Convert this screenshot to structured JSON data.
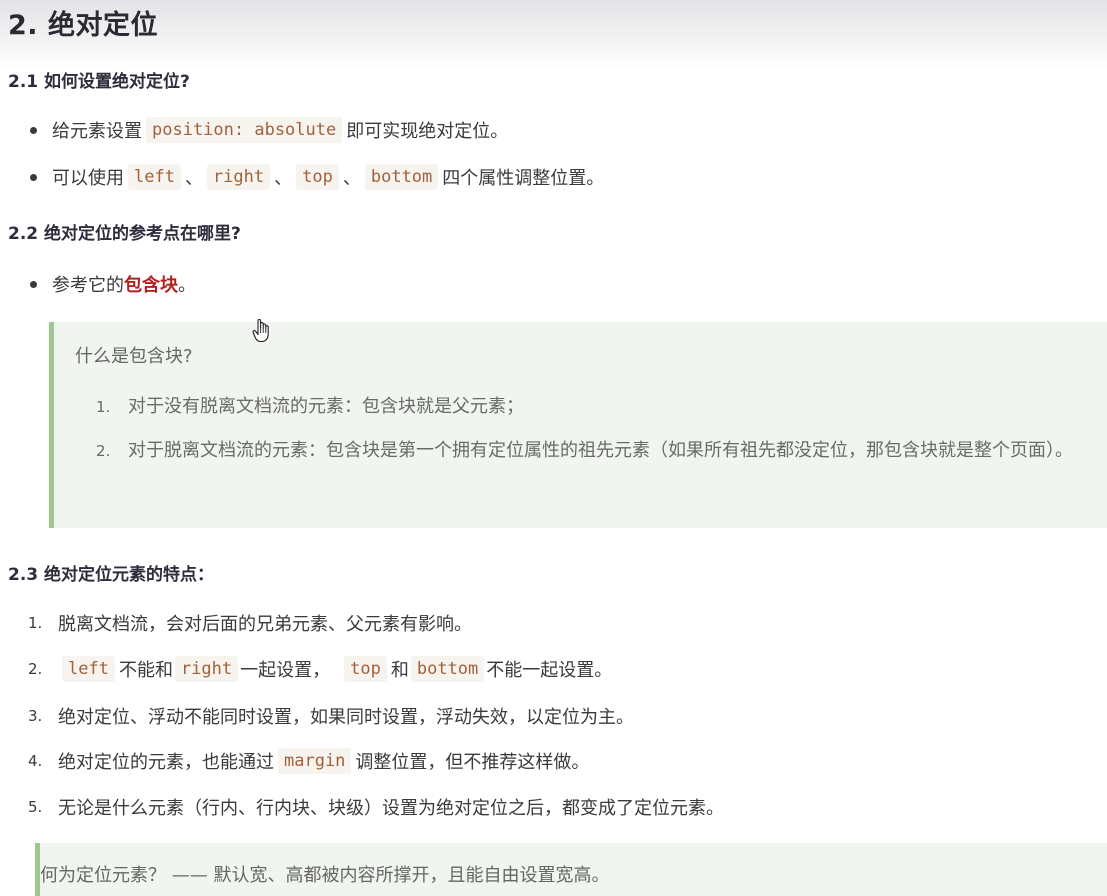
{
  "heading": "2. 绝对定位",
  "section1": {
    "title": "2.1 如何设置绝对定位?",
    "item1": {
      "prefix": "给元素设置",
      "code": "position: absolute",
      "suffix": "即可实现绝对定位。"
    },
    "item2": {
      "prefix": "可以使用",
      "code_left": "left",
      "sep1": "、",
      "code_right": "right",
      "sep2": "、",
      "code_top": "top",
      "sep3": "、",
      "code_bottom": "bottom",
      "suffix": "四个属性调整位置。"
    }
  },
  "section2": {
    "title": "2.2 绝对定位的参考点在哪里?",
    "item1": {
      "prefix": "参考它的",
      "strong": "包含块",
      "suffix": "。"
    },
    "quote": {
      "title": "什么是包含块?",
      "items": [
        {
          "num": "1.",
          "text": "对于没有脱离文档流的元素：包含块就是父元素；"
        },
        {
          "num": "2.",
          "text": "对于脱离文档流的元素：包含块是第一个拥有定位属性的祖先元素（如果所有祖先都没定位，那包含块就是整个页面）。"
        }
      ]
    }
  },
  "section3": {
    "title": "2.3 绝对定位元素的特点：",
    "items": {
      "i1": {
        "num": "1.",
        "text": "脱离文档流，会对后面的兄弟元素、父元素有影响。"
      },
      "i2": {
        "num": "2.",
        "code_left": "left",
        "t1": "不能和",
        "code_right": "right",
        "t2": "一起设置，",
        "code_top": "top",
        "t3": "和",
        "code_bottom": "bottom",
        "t4": "不能一起设置。"
      },
      "i3": {
        "num": "3.",
        "text": "绝对定位、浮动不能同时设置，如果同时设置，浮动失效，以定位为主。"
      },
      "i4": {
        "num": "4.",
        "prefix": "绝对定位的元素，也能通过",
        "code": "margin",
        "suffix": "调整位置，但不推荐这样做。"
      },
      "i5": {
        "num": "5.",
        "text": "无论是什么元素（行内、行内块、块级）设置为绝对定位之后，都变成了定位元素。"
      }
    },
    "quote": {
      "text": "何为定位元素？ —— 默认宽、高都被内容所撑开，且能自由设置宽高。"
    }
  },
  "colors": {
    "accent_red": "#b2221e",
    "code_text": "#a0623c",
    "quote_bar": "#9cc990",
    "quote_bg": "#f1f5ef"
  },
  "icons": {
    "cursor": "hand-cursor-icon"
  }
}
